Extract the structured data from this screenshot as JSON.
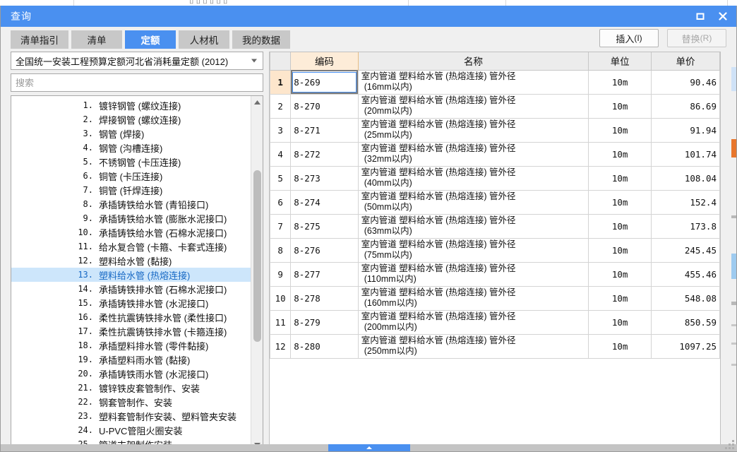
{
  "window": {
    "title": "查询",
    "maximize_icon": "maximize-icon",
    "close_icon": "close-icon"
  },
  "tabs": [
    {
      "label": "清单指引",
      "active": false
    },
    {
      "label": "清单",
      "active": false
    },
    {
      "label": "定额",
      "active": true
    },
    {
      "label": "人材机",
      "active": false
    },
    {
      "label": "我的数据",
      "active": false
    }
  ],
  "toolbar": {
    "insert_label": "插入",
    "insert_mnemonic": "(I)",
    "replace_label": "替换",
    "replace_mnemonic": "(R)",
    "replace_disabled": true
  },
  "left_panel": {
    "combo_value": "全国统一安装工程预算定额河北省消耗量定额 (2012)",
    "caret_icon": "chevron-down-icon",
    "search_placeholder": "搜索",
    "search_value": "",
    "scroll_up_icon": "scroll-up-arrow-icon",
    "scroll_down_icon": "scroll-down-arrow-icon",
    "selected_index": 13,
    "items": [
      {
        "num": "1.",
        "label": "镀锌钢管 (螺纹连接)"
      },
      {
        "num": "2.",
        "label": "焊接钢管 (螺纹连接)"
      },
      {
        "num": "3.",
        "label": "钢管 (焊接)"
      },
      {
        "num": "4.",
        "label": "钢管 (沟槽连接)"
      },
      {
        "num": "5.",
        "label": "不锈钢管 (卡压连接)"
      },
      {
        "num": "6.",
        "label": "铜管 (卡压连接)"
      },
      {
        "num": "7.",
        "label": "铜管 (钎焊连接)"
      },
      {
        "num": "8.",
        "label": "承插铸铁给水管 (青铅接口)"
      },
      {
        "num": "9.",
        "label": "承插铸铁给水管 (膨胀水泥接口)"
      },
      {
        "num": "10.",
        "label": "承插铸铁给水管 (石棉水泥接口)"
      },
      {
        "num": "11.",
        "label": "给水复合管 (卡箍、卡套式连接)"
      },
      {
        "num": "12.",
        "label": "塑料给水管 (黏接)"
      },
      {
        "num": "13.",
        "label": "塑料给水管 (热熔连接)"
      },
      {
        "num": "14.",
        "label": "承插铸铁排水管 (石棉水泥接口)"
      },
      {
        "num": "15.",
        "label": "承插铸铁排水管 (水泥接口)"
      },
      {
        "num": "16.",
        "label": "柔性抗震铸铁排水管 (柔性接口)"
      },
      {
        "num": "17.",
        "label": "柔性抗震铸铁排水管 (卡箍连接)"
      },
      {
        "num": "18.",
        "label": "承插塑料排水管 (零件黏接)"
      },
      {
        "num": "19.",
        "label": "承插塑料雨水管 (黏接)"
      },
      {
        "num": "20.",
        "label": "承插铸铁雨水管 (水泥接口)"
      },
      {
        "num": "21.",
        "label": "镀锌铁皮套管制作、安装"
      },
      {
        "num": "22.",
        "label": "钢套管制作、安装"
      },
      {
        "num": "23.",
        "label": "塑料套管制作安装、塑料管夹安装"
      },
      {
        "num": "24.",
        "label": "U-PVC管阻火圈安装"
      },
      {
        "num": "25.",
        "label": "管道支架制作安装"
      }
    ]
  },
  "grid": {
    "columns": [
      "",
      "编码",
      "名称",
      "单位",
      "单价"
    ],
    "selected_row": 1,
    "rows": [
      {
        "idx": "1",
        "code": "8-269",
        "name_l1": "室内管道 塑料给水管 (热熔连接) 管外径",
        "name_l2": "(16mm以内)",
        "unit": "10m",
        "price": "90.46"
      },
      {
        "idx": "2",
        "code": "8-270",
        "name_l1": "室内管道 塑料给水管 (热熔连接) 管外径",
        "name_l2": "(20mm以内)",
        "unit": "10m",
        "price": "86.69"
      },
      {
        "idx": "3",
        "code": "8-271",
        "name_l1": "室内管道 塑料给水管 (热熔连接) 管外径",
        "name_l2": "(25mm以内)",
        "unit": "10m",
        "price": "91.94"
      },
      {
        "idx": "4",
        "code": "8-272",
        "name_l1": "室内管道 塑料给水管 (热熔连接) 管外径",
        "name_l2": "(32mm以内)",
        "unit": "10m",
        "price": "101.74"
      },
      {
        "idx": "5",
        "code": "8-273",
        "name_l1": "室内管道 塑料给水管 (热熔连接) 管外径",
        "name_l2": "(40mm以内)",
        "unit": "10m",
        "price": "108.04"
      },
      {
        "idx": "6",
        "code": "8-274",
        "name_l1": "室内管道 塑料给水管 (热熔连接) 管外径",
        "name_l2": "(50mm以内)",
        "unit": "10m",
        "price": "152.4"
      },
      {
        "idx": "7",
        "code": "8-275",
        "name_l1": "室内管道 塑料给水管 (热熔连接) 管外径",
        "name_l2": "(63mm以内)",
        "unit": "10m",
        "price": "173.8"
      },
      {
        "idx": "8",
        "code": "8-276",
        "name_l1": "室内管道 塑料给水管 (热熔连接) 管外径",
        "name_l2": "(75mm以内)",
        "unit": "10m",
        "price": "245.45"
      },
      {
        "idx": "9",
        "code": "8-277",
        "name_l1": "室内管道 塑料给水管 (热熔连接) 管外径",
        "name_l2": "(110mm以内)",
        "unit": "10m",
        "price": "455.46"
      },
      {
        "idx": "10",
        "code": "8-278",
        "name_l1": "室内管道 塑料给水管 (热熔连接) 管外径",
        "name_l2": "(160mm以内)",
        "unit": "10m",
        "price": "548.08"
      },
      {
        "idx": "11",
        "code": "8-279",
        "name_l1": "室内管道 塑料给水管 (热熔连接) 管外径",
        "name_l2": "(200mm以内)",
        "unit": "10m",
        "price": "850.59"
      },
      {
        "idx": "12",
        "code": "8-280",
        "name_l1": "室内管道 塑料给水管 (热熔连接) 管外径",
        "name_l2": "(250mm以内)",
        "unit": "10m",
        "price": "1097.25"
      }
    ]
  },
  "splitter": {
    "collapse_icon": "collapse-up-icon"
  },
  "colors": {
    "accent": "#4a90f0",
    "header_code": "#fdecd8",
    "row_selected": "#fde6cc",
    "tree_selected": "#cde6fb"
  }
}
